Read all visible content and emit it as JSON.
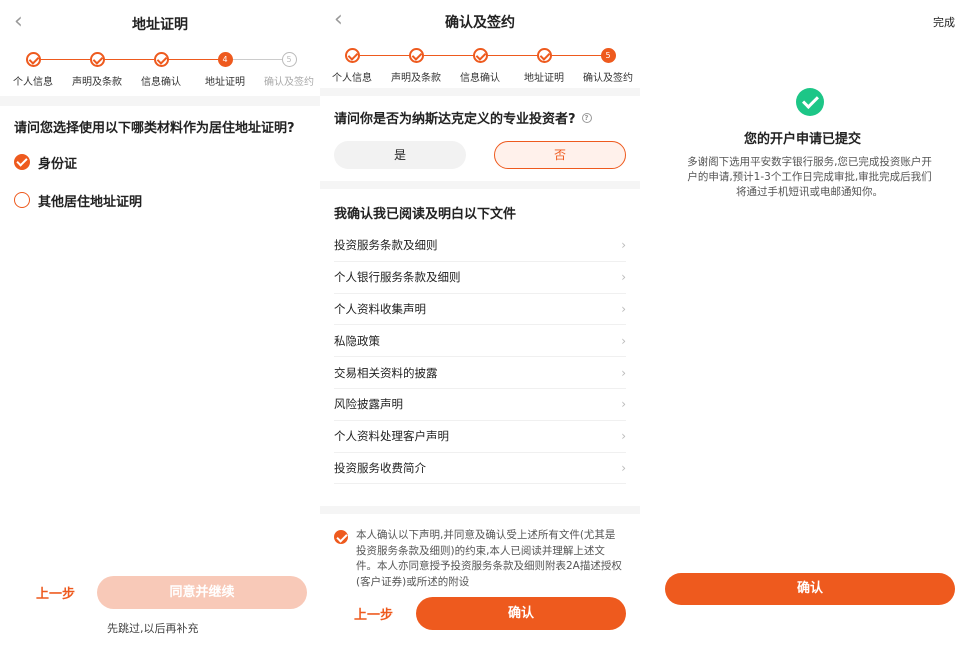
{
  "panel1": {
    "title": "地址证明",
    "steps": [
      "个人信息",
      "声明及条款",
      "信息确认",
      "地址证明",
      "确认及签约"
    ],
    "current_step_number": "4",
    "todo_step_number": "5",
    "question": "请问您选择使用以下哪类材料作为居住地址证明?",
    "options": [
      {
        "label": "身份证",
        "selected": true
      },
      {
        "label": "其他居住地址证明",
        "selected": false
      }
    ],
    "prev_label": "上一步",
    "continue_label": "同意并继续",
    "skip_label": "先跳过,以后再补充"
  },
  "panel2": {
    "title": "确认及签约",
    "steps": [
      "个人信息",
      "声明及条款",
      "信息确认",
      "地址证明",
      "确认及签约"
    ],
    "current_step_number": "5",
    "question": "请问你是否为纳斯达克定义的专业投资者?",
    "yes_label": "是",
    "no_label": "否",
    "docs_heading": "我确认我已阅读及明白以下文件",
    "documents": [
      "投资服务条款及细则",
      "个人银行服务条款及细则",
      "个人资料收集声明",
      "私隐政策",
      "交易相关资料的披露",
      "风险披露声明",
      "个人资料处理客户声明",
      "投资服务收费简介"
    ],
    "consent_text": "本人确认以下声明,并同意及确认受上述所有文件(尤其是投资服务条款及细则)的约束,本人已阅读并理解上述文件。本人亦同意授予投资服务条款及细则附表2A描述授权(客户证券)或所述的附设",
    "prev_label": "上一步",
    "confirm_label": "确认"
  },
  "panel3": {
    "done_label": "完成",
    "title": "您的开户申请已提交",
    "description": "多谢阁下选用平安数字银行服务,您已完成投资账户开户的申请,预计1-3个工作日完成审批,审批完成后我们将通过手机短讯或电邮通知你。",
    "confirm_label": "确认"
  },
  "icons": {
    "back": "chevron-left-icon",
    "check": "check-icon",
    "help": "question-circle-icon",
    "chevron": "chevron-right-icon",
    "success": "success-check-icon"
  },
  "colors": {
    "accent": "#ee5a1e",
    "accent_disabled": "#f8c9b8",
    "success": "#1dc687"
  }
}
